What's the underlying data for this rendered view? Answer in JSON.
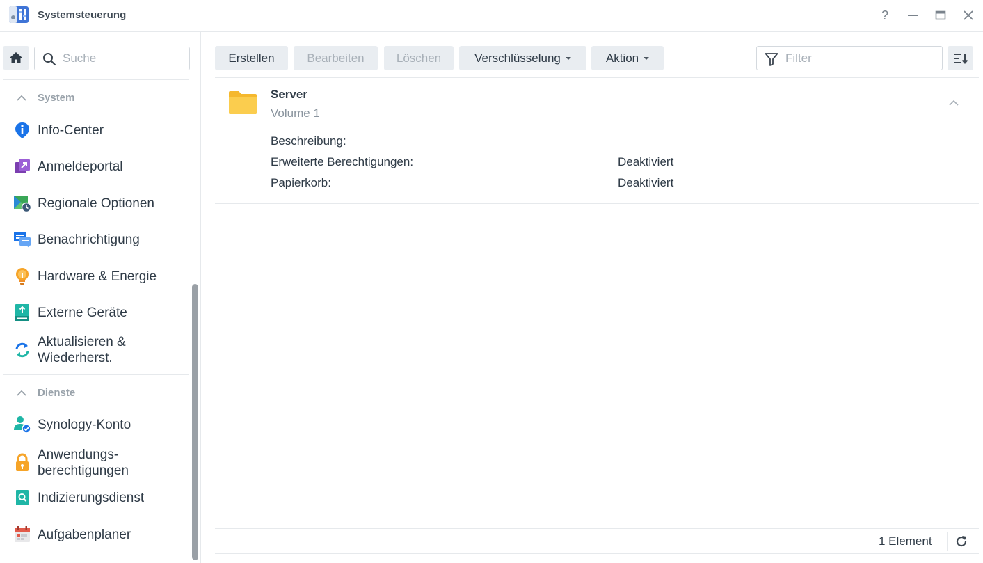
{
  "window": {
    "title": "Systemsteuerung",
    "help_label": "?"
  },
  "sidebar": {
    "search_placeholder": "Suche",
    "sections": [
      {
        "label": "System",
        "items": [
          {
            "label": "Info-Center",
            "icon": "info-icon"
          },
          {
            "label": "Anmeldeportal",
            "icon": "login-portal-icon"
          },
          {
            "label": "Regionale Optionen",
            "icon": "regional-options-icon"
          },
          {
            "label": "Benachrichtigung",
            "icon": "notification-icon"
          },
          {
            "label": "Hardware & Energie",
            "icon": "lightbulb-icon"
          },
          {
            "label": "Externe Geräte",
            "icon": "external-devices-icon"
          },
          {
            "label": "Aktualisieren & Wiederherst.",
            "label_line1": "Aktualisieren &",
            "label_line2": "Wiederherst.",
            "icon": "update-restore-icon"
          }
        ]
      },
      {
        "label": "Dienste",
        "items": [
          {
            "label": "Synology-Konto",
            "icon": "synology-account-icon"
          },
          {
            "label": "Anwendungsberechtigungen",
            "label_line1": "Anwendungs-",
            "label_line2": "berechtigungen",
            "icon": "lock-icon"
          },
          {
            "label": "Indizierungsdienst",
            "icon": "indexing-service-icon"
          },
          {
            "label": "Aufgabenplaner",
            "icon": "calendar-icon"
          }
        ]
      }
    ]
  },
  "toolbar": {
    "create": "Erstellen",
    "edit": "Bearbeiten",
    "delete": "Löschen",
    "encryption": "Verschlüsselung",
    "action": "Aktion",
    "filter_placeholder": "Filter"
  },
  "share": {
    "name": "Server",
    "volume": "Volume 1",
    "properties": [
      {
        "label": "Beschreibung:",
        "value": ""
      },
      {
        "label": "Erweiterte Berechtigungen:",
        "value": "Deaktiviert"
      },
      {
        "label": "Papierkorb:",
        "value": "Deaktiviert"
      }
    ]
  },
  "footer": {
    "count_text": "1 Element"
  },
  "colors": {
    "accent": "#1a73e8",
    "button_bg": "#e9edf1",
    "folder": "#f9c23c"
  }
}
